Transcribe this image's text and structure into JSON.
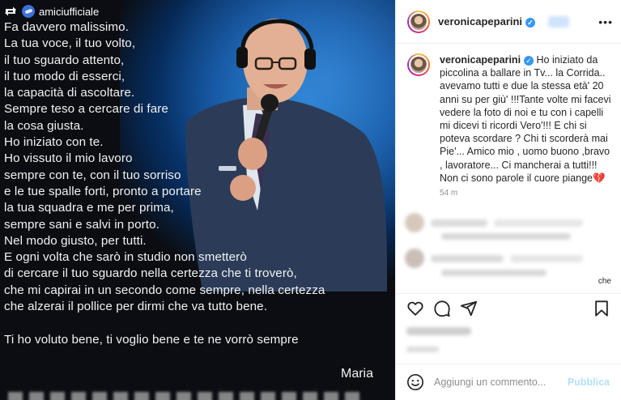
{
  "post_image": {
    "repost_user": "amiciufficiale",
    "poem_lines_a": [
      "Fa davvero malissimo.",
      "La tua voce, il tuo volto,",
      "il tuo sguardo attento,",
      "il tuo modo di esserci,",
      "la capacità di ascoltare.",
      "Sempre teso a cercare di fare",
      "la cosa giusta.",
      "Ho iniziato con te.",
      "Ho vissuto il mio lavoro",
      "sempre con te, con il tuo sorriso",
      "e le tue spalle forti, pronto a portare",
      "la tua squadra e me per prima,",
      "sempre sani e salvi in porto.",
      "Nel modo giusto, per tutti.",
      "E ogni volta che sarò in studio non smetterò",
      "di cercare il tuo sguardo nella certezza che ti troverò,",
      "che mi capirai in un secondo come sempre, nella certezza",
      "che alzerai il pollice per dirmi che va tutto bene."
    ],
    "poem_line_b": "Ti ho voluto bene, ti voglio bene e te ne vorrò sempre",
    "signature": "Maria"
  },
  "header": {
    "username": "veronicapeparini",
    "verified_mark": "✓",
    "more_icon": "•••"
  },
  "caption": {
    "username": "veronicapeparini",
    "text": "Ho iniziato da piccolina a ballare in Tv... la Corrida.. avevamo tutti e due la stessa età' 20 anni su per giù' !!!Tante volte mi facevi vedere la foto di noi e tu con i capelli mi dicevi ti ricordi Vero'!!! E chi si poteva scordare ? Chi ti scorderà mai Pie'... Amico mio , uomo buono ,bravo , lavoratore... Ci mancherai a tutti!!! Non ci sono parole il cuore piange💔",
    "timestamp": "54 m"
  },
  "comments": {
    "partial_text": "che"
  },
  "actions": {
    "icons": [
      "heart-icon",
      "comment-icon",
      "share-icon",
      "bookmark-icon"
    ]
  },
  "comment_bar": {
    "placeholder": "Aggiungi un commento...",
    "publish_label": "Pubblica"
  },
  "colors": {
    "link_blue": "#3897f0",
    "publish_disabled": "#b2dffc",
    "secondary_text": "#8e8e8e"
  }
}
